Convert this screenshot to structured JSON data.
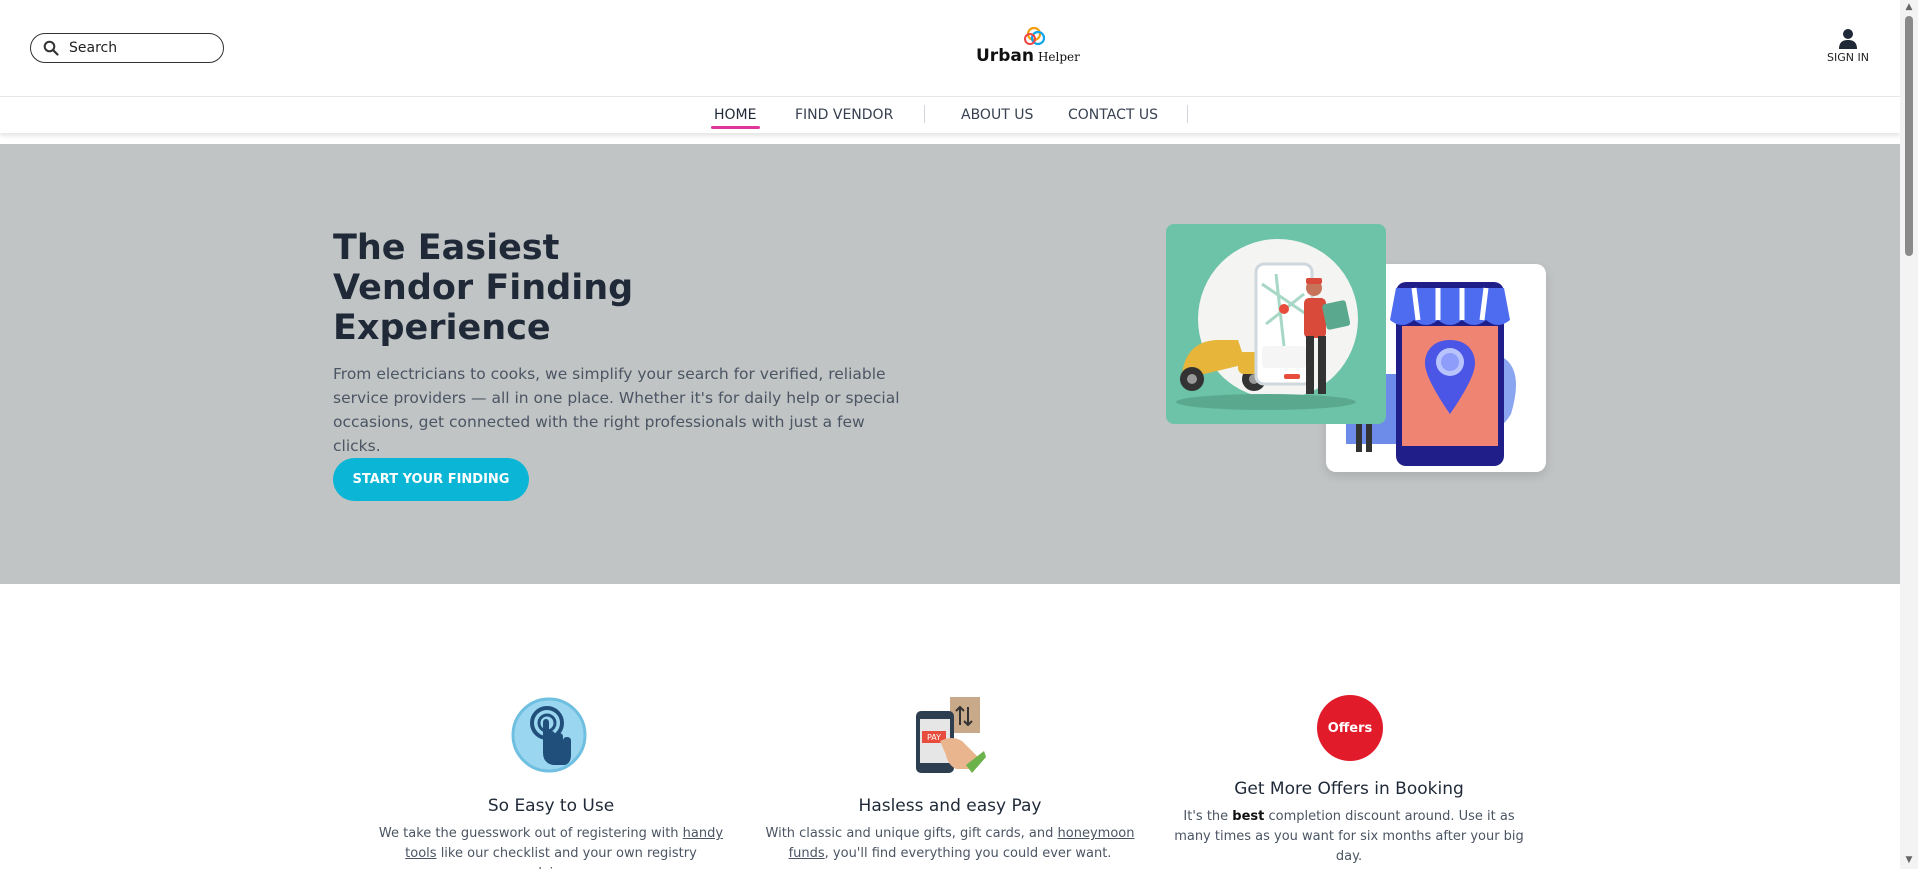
{
  "header": {
    "search_placeholder": "Search",
    "logo_primary": "Urban",
    "logo_secondary": "Helper",
    "signin_label": "SIGN IN"
  },
  "nav": {
    "items": [
      {
        "label": "HOME",
        "active": true
      },
      {
        "label": "FIND VENDOR",
        "active": false
      },
      {
        "label": "ABOUT US",
        "active": false
      },
      {
        "label": "CONTACT US",
        "active": false
      }
    ],
    "active_color": "#e0359a"
  },
  "hero": {
    "title_line1": "The Easiest",
    "title_line2": "Vendor Finding",
    "title_line3": "Experience",
    "description": "From electricians to cooks, we simplify your search for verified, reliable service providers — all in one place. Whether it's for daily help or special occasions, get connected with the right professionals with just a few clicks.",
    "cta_label": "START YOUR FINDING",
    "cta_color": "#0bb5d5",
    "background": "#c1c4c5"
  },
  "features": [
    {
      "icon": "tap-hand-icon",
      "title": "So Easy to Use",
      "text_before": "We take the guesswork out of registering with ",
      "link": "handy tools",
      "text_after": " like our checklist and your own registry advisor."
    },
    {
      "icon": "pay-phone-icon",
      "title": "Hasless and easy Pay",
      "text_before": "With classic and unique gifts, gift cards, and ",
      "link": "honeymoon funds",
      "text_after": ", you'll find everything you could ever want."
    },
    {
      "icon": "offers-badge-icon",
      "badge_label": "Offers",
      "badge_color": "#e21b2a",
      "title": "Get More Offers in Booking",
      "text_before": "It's the ",
      "bold": "best",
      "text_after": " completion discount around. Use it as many times as you want for six months after your big day."
    }
  ]
}
